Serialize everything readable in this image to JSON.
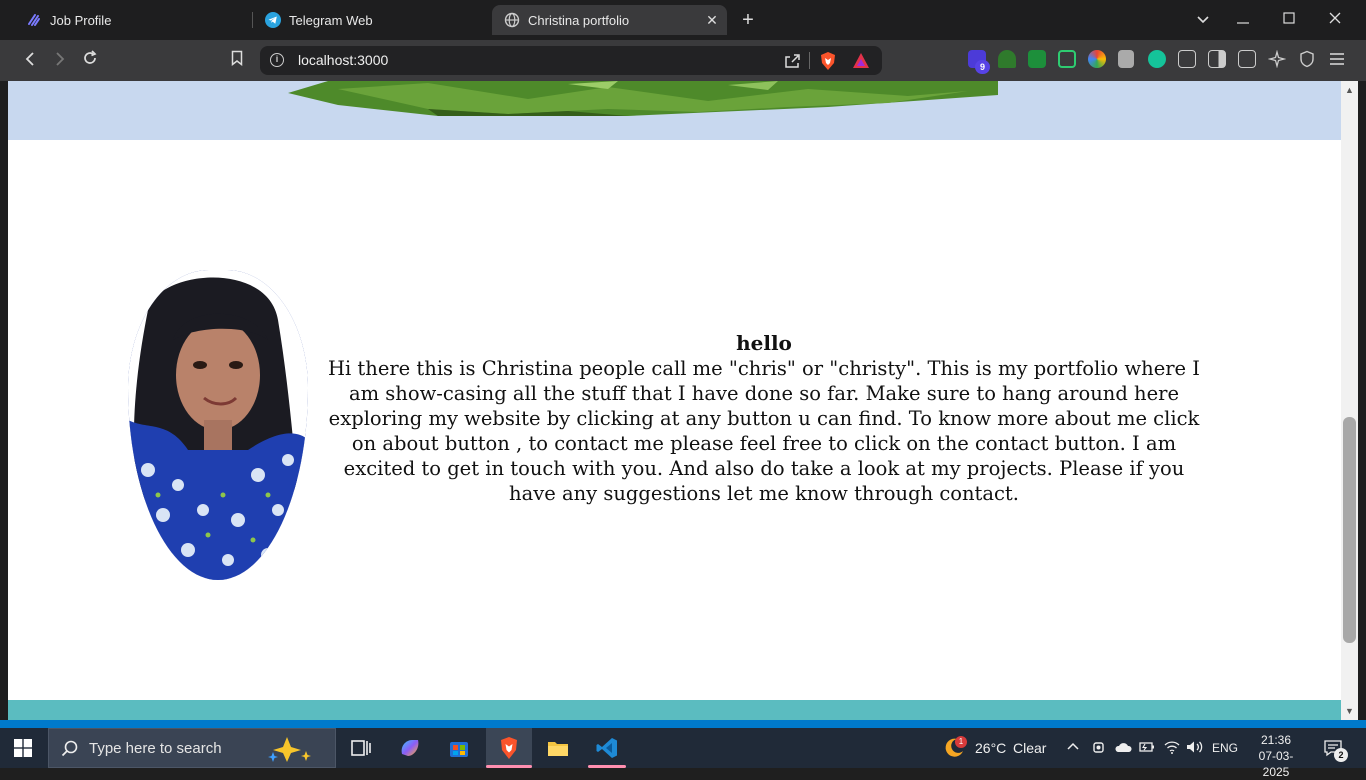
{
  "browser": {
    "tabs": [
      {
        "label": "Job Profile",
        "icon": "job-profile-icon",
        "active": false
      },
      {
        "label": "Telegram Web",
        "icon": "telegram-icon",
        "active": false
      },
      {
        "label": "Christina portfolio",
        "icon": "globe-icon",
        "active": true
      }
    ],
    "new_tab": "+",
    "url": "localhost:3000",
    "extension_badge": "9"
  },
  "page": {
    "intro": {
      "heading": "hello",
      "body": "Hi there this is Christina people call me \"chris\" or \"christy\". This is my portfolio where I am show-casing all the stuff that I have done so far. Make sure to hang around here exploring my website by clicking at any button u can find. To know more about me click on about button , to contact me please feel free to click on the contact button. I am excited to get in touch with you. And also do take a look at my projects. Please if you have any suggestions let me know through contact."
    },
    "colors": {
      "hero_band": "#c8d8ef",
      "footer_band": "#5bbcc0",
      "background": "#ffffff"
    }
  },
  "taskbar": {
    "search_placeholder": "Type here to search",
    "weather": {
      "temp": "26°C",
      "condition": "Clear",
      "badge": "1"
    },
    "language": "ENG",
    "time": "21:36",
    "date": "07-03-2025",
    "notifications": "2"
  }
}
